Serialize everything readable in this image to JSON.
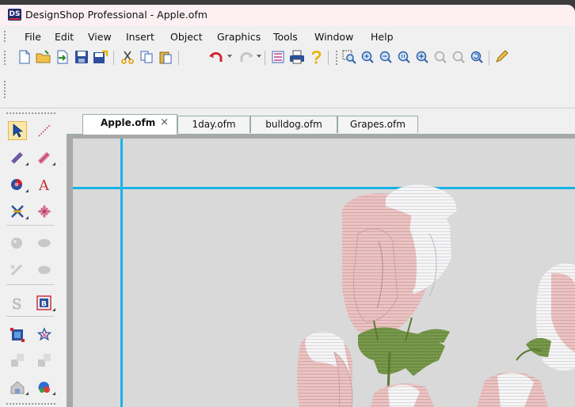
{
  "window": {
    "title": "DesignShop Professional - Apple.ofm",
    "logo_text": "DS"
  },
  "menu": [
    "File",
    "Edit",
    "View",
    "Insert",
    "Object",
    "Graphics",
    "Tools",
    "Window",
    "Help"
  ],
  "toolbar": {
    "icons": [
      "new-icon",
      "open-icon",
      "import-icon",
      "save-icon",
      "export-icon",
      "cut-icon",
      "copy-icon",
      "paste-icon",
      "undo-icon",
      "redo-icon",
      "color-sequence-icon",
      "print-icon",
      "help-icon",
      "zoom-box-icon",
      "zoom-in-icon",
      "zoom-out-icon",
      "zoom-1to1-icon",
      "zoom-all-icon",
      "zoom-fit-icon",
      "zoom-previous-icon",
      "zoom-refresh-icon",
      "pencil-icon"
    ]
  },
  "tools": {
    "icons": [
      "select-arrow-icon",
      "line-tool-icon",
      "satin-tool-icon",
      "fill-tool-icon",
      "color-wheel-icon",
      "text-a-icon",
      "cross-stitch-icon",
      "pattern-fill-icon",
      "disabled-tool-1-icon",
      "disabled-tool-2-icon",
      "disabled-tool-3-icon",
      "disabled-tool-4-icon",
      "s-disabled-icon",
      "b-border-icon",
      "resize-box-icon",
      "star-tool-icon",
      "disabled-tool-5-icon",
      "disabled-tool-6-icon",
      "house-tool-icon",
      "blob-tool-icon"
    ]
  },
  "tabs": [
    {
      "label": "Apple.ofm",
      "active": true,
      "close": "×"
    },
    {
      "label": "1day.ofm",
      "active": false
    },
    {
      "label": "bulldog.ofm",
      "active": false
    },
    {
      "label": "Grapes.ofm",
      "active": false
    }
  ],
  "colors": {
    "guide": "#19b3e6",
    "petal_pink": "#ebc3c3",
    "petal_white": "#f4f4f4",
    "leaf_green": "#7a9a4e",
    "canvas": "#d9d9d9"
  }
}
